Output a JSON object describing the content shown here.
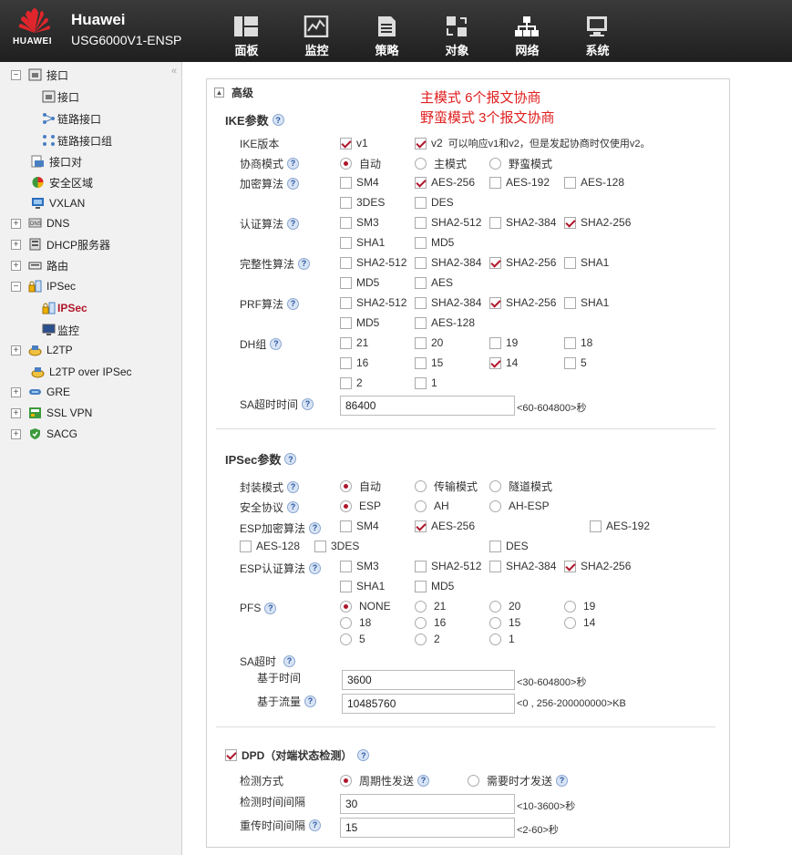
{
  "header": {
    "logo_text": "HUAWEI",
    "brand": "Huawei",
    "model": "USG6000V1-ENSP",
    "nav": [
      {
        "label": "面板",
        "icon": "dashboard-icon"
      },
      {
        "label": "监控",
        "icon": "monitor-icon"
      },
      {
        "label": "策略",
        "icon": "policy-icon"
      },
      {
        "label": "对象",
        "icon": "object-icon"
      },
      {
        "label": "网络",
        "icon": "network-icon"
      },
      {
        "label": "系统",
        "icon": "system-icon"
      }
    ],
    "active_nav": "网络"
  },
  "sidebar": {
    "collapse_glyph": "«",
    "items": [
      {
        "label": "接口"
      },
      {
        "label": "接口"
      },
      {
        "label": "链路接口"
      },
      {
        "label": "链路接口组"
      },
      {
        "label": "接口对"
      },
      {
        "label": "安全区域"
      },
      {
        "label": "VXLAN"
      },
      {
        "label": "DNS"
      },
      {
        "label": "DHCP服务器"
      },
      {
        "label": "路由"
      },
      {
        "label": "IPSec"
      },
      {
        "label": "IPSec"
      },
      {
        "label": "监控"
      },
      {
        "label": "L2TP"
      },
      {
        "label": "L2TP over IPSec"
      },
      {
        "label": "GRE"
      },
      {
        "label": "SSL VPN"
      },
      {
        "label": "SACG"
      }
    ]
  },
  "advanced": {
    "title": "高级",
    "note_line1": "主模式 6个报文协商",
    "note_line2": "野蛮模式 3个报文协商"
  },
  "ike": {
    "title": "IKE参数",
    "version_label": "IKE版本",
    "v1": "v1",
    "v2": "v2",
    "v2_note": "可以响应v1和v2，但是发起协商时仅使用v2。",
    "mode_label": "协商模式",
    "mode_auto": "自动",
    "mode_main": "主模式",
    "mode_aggr": "野蛮模式",
    "enc_label": "加密算法",
    "enc": [
      "SM4",
      "AES-256",
      "AES-192",
      "AES-128",
      "3DES",
      "DES"
    ],
    "auth_label": "认证算法",
    "auth": [
      "SM3",
      "SHA2-512",
      "SHA2-384",
      "SHA2-256",
      "SHA1",
      "MD5"
    ],
    "integ_label": "完整性算法",
    "integ": [
      "SHA2-512",
      "SHA2-384",
      "SHA2-256",
      "SHA1",
      "MD5",
      "AES"
    ],
    "prf_label": "PRF算法",
    "prf": [
      "SHA2-512",
      "SHA2-384",
      "SHA2-256",
      "SHA1",
      "MD5",
      "AES-128"
    ],
    "dh_label": "DH组",
    "dh": [
      "21",
      "20",
      "19",
      "18",
      "16",
      "15",
      "14",
      "5",
      "2",
      "1"
    ],
    "sa_label": "SA超时时间",
    "sa_value": "86400",
    "sa_hint": "<60-604800>秒"
  },
  "ipsec": {
    "title": "IPSec参数",
    "encap_label": "封装模式",
    "encap": [
      "自动",
      "传输模式",
      "隧道模式"
    ],
    "proto_label": "安全协议",
    "proto": [
      "ESP",
      "AH",
      "AH-ESP"
    ],
    "esp_enc_label": "ESP加密算法",
    "esp_enc": [
      "SM4",
      "AES-256",
      "AES-192",
      "AES-128",
      "3DES",
      "DES"
    ],
    "esp_auth_label": "ESP认证算法",
    "esp_auth": [
      "SM3",
      "SHA2-512",
      "SHA2-384",
      "SHA2-256",
      "SHA1",
      "MD5"
    ],
    "pfs_label": "PFS",
    "pfs": [
      "NONE",
      "21",
      "20",
      "19",
      "18",
      "16",
      "15",
      "14",
      "5",
      "2",
      "1"
    ],
    "sa_label": "SA超时",
    "time_label": "基于时间",
    "time_value": "3600",
    "time_hint": "<30-604800>秒",
    "flow_label": "基于流量",
    "flow_value": "10485760",
    "flow_hint": "<0 , 256-200000000>KB"
  },
  "dpd": {
    "title": "DPD（对端状态检测）",
    "method_label": "检测方式",
    "periodic": "周期性发送",
    "ondemand": "需要时才发送",
    "interval_label": "检测时间间隔",
    "interval_value": "30",
    "interval_hint": "<10-3600>秒",
    "retry_label": "重传时间间隔",
    "retry_value": "15",
    "retry_hint": "<2-60>秒"
  },
  "help_glyph": "?",
  "collapse_box_glyph": "▲",
  "plus_glyph": "+",
  "minus_glyph": "−"
}
